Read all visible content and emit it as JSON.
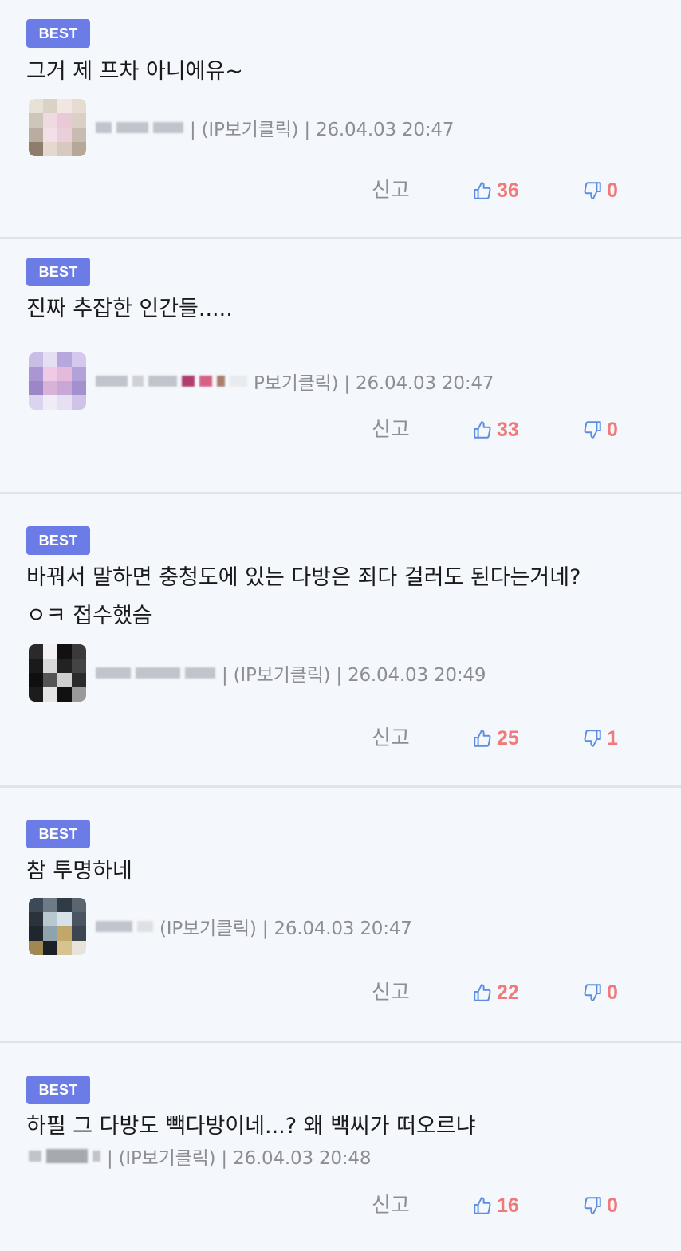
{
  "colors": {
    "background": "#f4f7fc",
    "badge": "#6b7ce6",
    "count": "#f07a7a",
    "thumb_icon": "#5b8ee0",
    "meta_text": "#8d8d93",
    "divider": "#dfe3ec"
  },
  "icons": {
    "like": "thumbs-up-icon",
    "dislike": "thumbs-down-icon"
  },
  "labels": {
    "best": "BEST",
    "report": "신고"
  },
  "comments": [
    {
      "text": "그거 제 프차 아니에유~",
      "meta": "| (IP보기클릭) | 26.04.03 20:47",
      "likes": "36",
      "dislikes": "0",
      "has_avatar": true
    },
    {
      "text": "진짜 추잡한 인간들.....",
      "meta": "P보기클릭) | 26.04.03 20:47",
      "likes": "33",
      "dislikes": "0",
      "has_avatar": true
    },
    {
      "text": "바꿔서 말하면 충청도에 있는 다방은 죄다 걸러도 된다는거네?\nㅇㅋ 접수했슴",
      "meta": "| (IP보기클릭) | 26.04.03 20:49",
      "likes": "25",
      "dislikes": "1",
      "has_avatar": true
    },
    {
      "text": "참 투명하네",
      "meta": "(IP보기클릭) | 26.04.03 20:47",
      "likes": "22",
      "dislikes": "0",
      "has_avatar": true
    },
    {
      "text": "하필 그 다방도 빽다방이네...? 왜 백씨가 떠오르냐",
      "meta": "| (IP보기클릭) | 26.04.03 20:48",
      "likes": "16",
      "dislikes": "0",
      "has_avatar": false
    }
  ]
}
